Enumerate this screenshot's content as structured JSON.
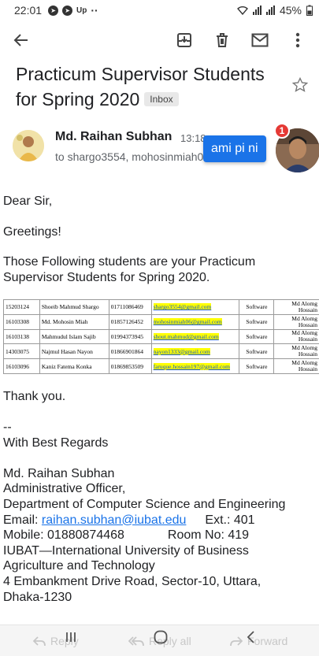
{
  "status_bar": {
    "time": "22:01",
    "app_icons": [
      "messenger-icon",
      "messenger-icon",
      "up-icon",
      "more-dots-icon"
    ],
    "up_label": "Up",
    "dots": "··",
    "battery": "45%"
  },
  "toolbar": {
    "icons": [
      "back-arrow-icon",
      "archive-icon",
      "delete-icon",
      "mark-unread-icon",
      "more-vert-icon"
    ]
  },
  "email": {
    "subject": "Practicum Supervisor Students for Spring 2020",
    "label": "Inbox",
    "sender_name": "Md. Raihan Subhan",
    "time": "13:18",
    "recipients": "to shargo3554, mohosinmiah06"
  },
  "chat_overlay": {
    "message": "ami pi ni",
    "badge_count": "1"
  },
  "body": {
    "greeting": "Dear Sir,",
    "greetings": "Greetings!",
    "intro": "Those Following students are your Practicum Supervisor Students for Spring 2020.",
    "thanks": "Thank you.",
    "separator": "--",
    "regards": "With Best Regards",
    "signature": {
      "name": "Md. Raihan Subhan",
      "title": "Administrative Officer,",
      "dept": "Department of Computer Science and Engineering",
      "email_label": "Email: ",
      "email": "raihan.subhan@iubat.edu",
      "ext": "Ext.: 401",
      "mobile": "Mobile: 01880874468",
      "room": "Room No: 419",
      "org_line1": "IUBAT—International University of Business",
      "org_line2": "Agriculture and Technology",
      "address1": "4 Embankment Drive Road, Sector-10, Uttara,",
      "address2": "Dhaka-1230"
    }
  },
  "students": [
    {
      "id": "15203124",
      "name": "Shoeib Mahmud Shargo",
      "phone": "01711086469",
      "email": "shargo3554@gmail.com",
      "dept": "Software",
      "supervisor": "Md Alomg Hossain"
    },
    {
      "id": "16103308",
      "name": "Md. Mohosin Miah",
      "phone": "01857126452",
      "email": "mohosinmiah06@gmail.com",
      "dept": "Software",
      "supervisor": "Md Alomg Hossain"
    },
    {
      "id": "16103138",
      "name": "Mahmudul Islam Sajib",
      "phone": "01994373945",
      "email": "shout.mahmud@gmail.com",
      "dept": "Software",
      "supervisor": "Md Alomg Hossain"
    },
    {
      "id": "14303075",
      "name": "Najmul Hasan Nayon",
      "phone": "01866901864",
      "email": "nayon1333@gmail.com",
      "dept": "Software",
      "supervisor": "Md Alomg Hossain"
    },
    {
      "id": "16103096",
      "name": "Kaniz Fatema Konka",
      "phone": "01869853509",
      "email": "faruque.hossain197@gmail.com",
      "dept": "Software",
      "supervisor": "Md Alomg Hossain"
    }
  ],
  "actions": {
    "reply": "Reply",
    "reply_all": "Reply all",
    "forward": "Forward"
  },
  "colors": {
    "accent": "#1a73e8",
    "badge": "#e53935",
    "highlight": "#ffff00"
  }
}
